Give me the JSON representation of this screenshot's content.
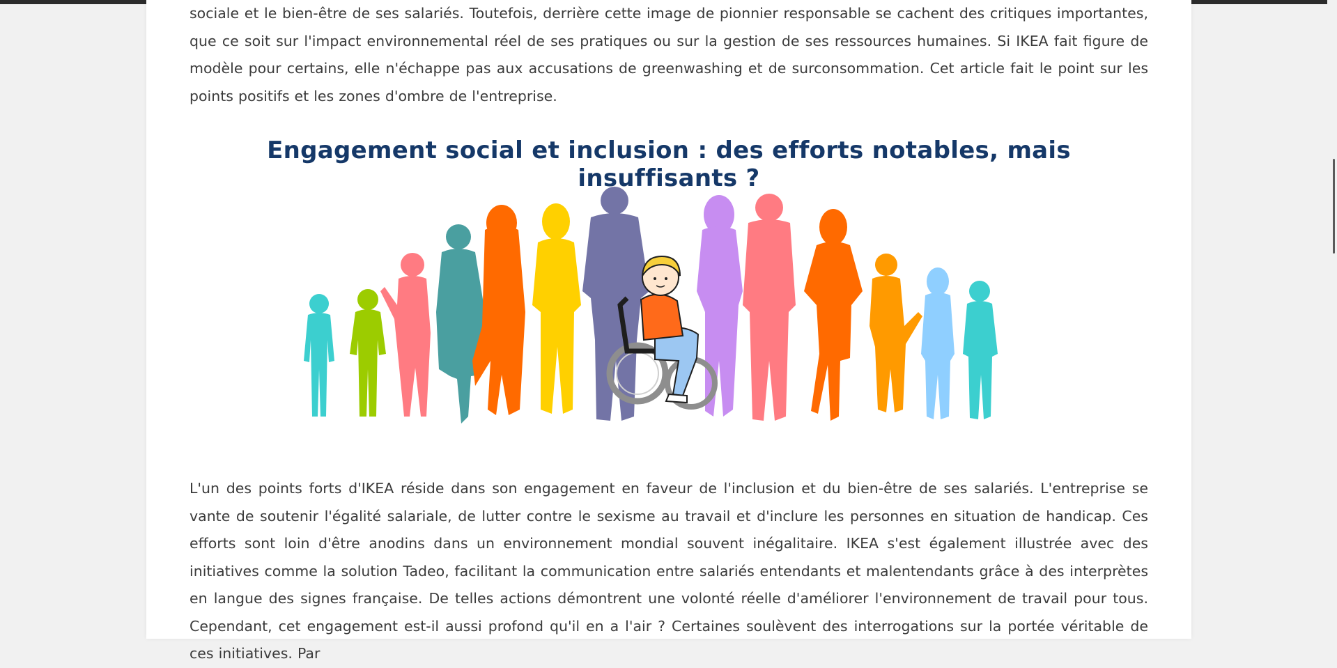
{
  "article": {
    "intro_text": "sociale et le bien-être de ses salariés. Toutefois, derrière cette image de pionnier responsable se cachent des critiques importantes, que ce soit sur l'impact environnemental réel de ses pratiques ou sur la gestion de ses ressources humaines. Si IKEA fait figure de modèle pour certains, elle n'échappe pas aux accusations de greenwashing et de surconsommation. Cet article fait le point sur les points positifs et les zones d'ombre de l'entreprise.",
    "section_heading": "Engagement social et inclusion : des efforts notables, mais insuffisants ?",
    "body_text": "L'un des points forts d'IKEA réside dans son engagement en faveur de l'inclusion et du bien-être de ses salariés. L'entreprise se vante de soutenir l'égalité salariale, de lutter contre le sexisme au travail et d'inclure les personnes en situation de handicap. Ces efforts sont loin d'être anodins dans un environnement mondial souvent inégalitaire. IKEA s'est également illustrée avec des initiatives comme la solution Tadeo, facilitant la communication entre salariés entendants et malentendants grâce à des interprètes en langue des signes française. De telles actions démontrent une volonté réelle d'améliorer l'environnement de travail pour tous. Cependant, cet engagement est-il aussi profond qu'il en a l'air ? Certaines soulèvent des interrogations sur la portée véritable de ces initiatives. Par"
  },
  "colors": {
    "heading": "#153868",
    "text": "#3b3b3b",
    "page_background": "#f1f1f1"
  }
}
